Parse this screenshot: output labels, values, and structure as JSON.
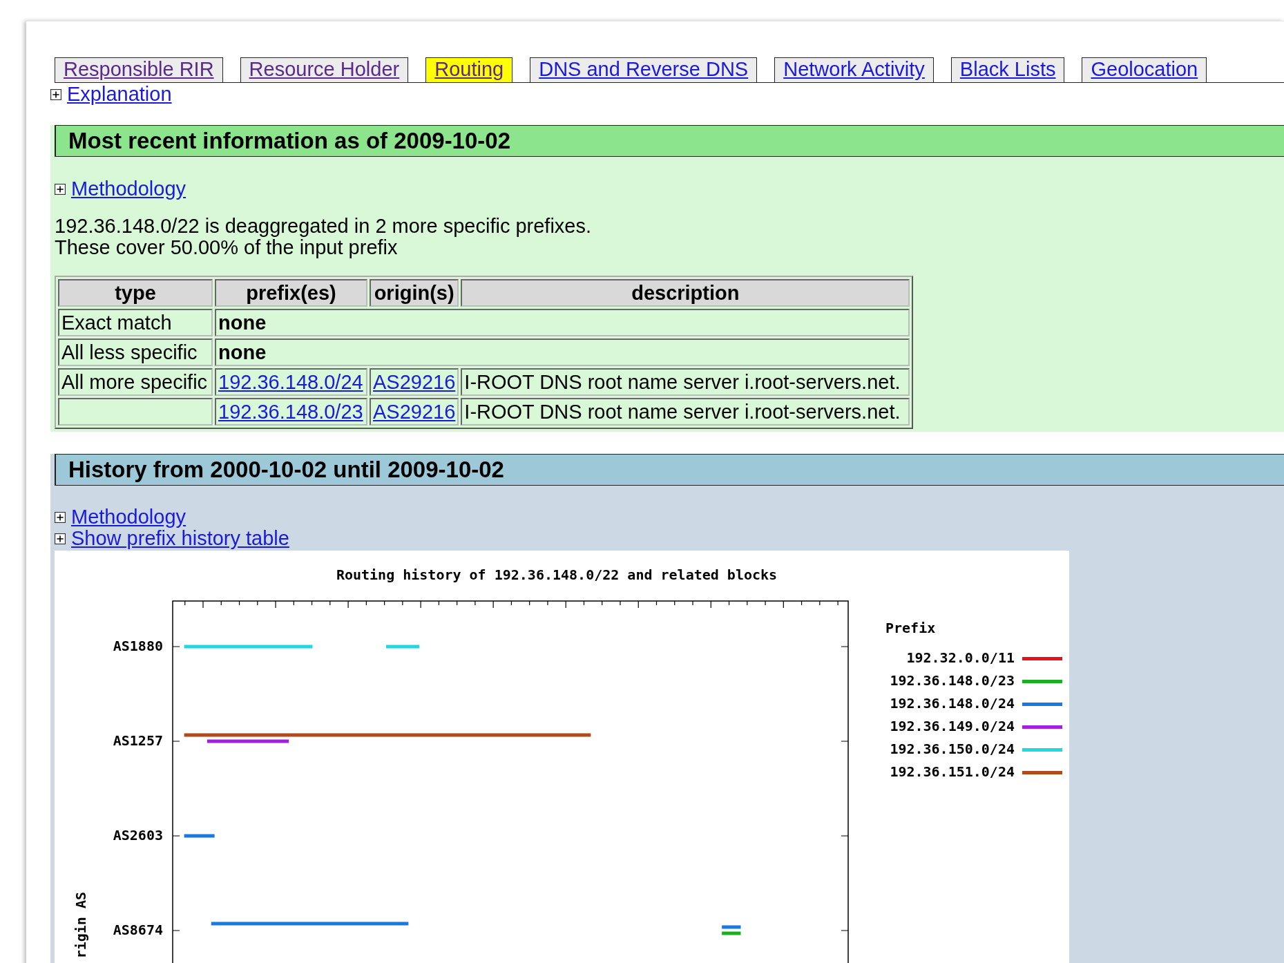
{
  "tabs": [
    {
      "label": "Responsible RIR",
      "selected": false,
      "visited": true
    },
    {
      "label": "Resource Holder",
      "selected": false,
      "visited": true
    },
    {
      "label": "Routing",
      "selected": true,
      "visited": true
    },
    {
      "label": "DNS and Reverse DNS",
      "selected": false,
      "visited": false
    },
    {
      "label": "Network Activity",
      "selected": false,
      "visited": false
    },
    {
      "label": "Black Lists",
      "selected": false,
      "visited": false
    },
    {
      "label": "Geolocation",
      "selected": false,
      "visited": false
    }
  ],
  "explanation_link": "Explanation",
  "recent": {
    "heading": "Most recent information as of 2009-10-02",
    "methodology_link": "Methodology",
    "summary": [
      "192.36.148.0/22 is deaggregated in 2 more specific prefixes.",
      "These cover 50.00% of the input prefix"
    ],
    "table": {
      "columns": [
        "type",
        "prefix(es)",
        "origin(s)",
        "description"
      ],
      "rows": [
        {
          "kind": "none",
          "type": "Exact match",
          "value": "none"
        },
        {
          "kind": "none",
          "type": "All less specific",
          "value": "none"
        },
        {
          "kind": "match",
          "type": "All more specific",
          "prefix": "192.36.148.0/24",
          "origin": "AS29216",
          "description": "I-ROOT DNS root name server i.root-servers.net."
        },
        {
          "kind": "match",
          "prefix": "192.36.148.0/23",
          "origin": "AS29216",
          "description": "I-ROOT DNS root name server i.root-servers.net."
        }
      ]
    }
  },
  "history": {
    "heading": "History from 2000-10-02 until 2009-10-02",
    "links": [
      "Methodology",
      "Show prefix history table"
    ],
    "chart": {
      "title": "Routing history of 192.36.148.0/22 and related blocks",
      "ylabel": "rigin AS",
      "y_labels": [
        "AS1880",
        "AS1257",
        "AS2603",
        "AS8674"
      ],
      "legend_title": "Prefix",
      "legend": [
        {
          "label": "192.32.0.0/11",
          "color": "#e8101a"
        },
        {
          "label": "192.36.148.0/23",
          "color": "#18b020"
        },
        {
          "label": "192.36.148.0/24",
          "color": "#1a78e0"
        },
        {
          "label": "192.36.149.0/24",
          "color": "#a020e0"
        },
        {
          "label": "192.36.150.0/24",
          "color": "#20d8e0"
        },
        {
          "label": "192.36.151.0/24",
          "color": "#b04a18"
        }
      ]
    }
  }
}
